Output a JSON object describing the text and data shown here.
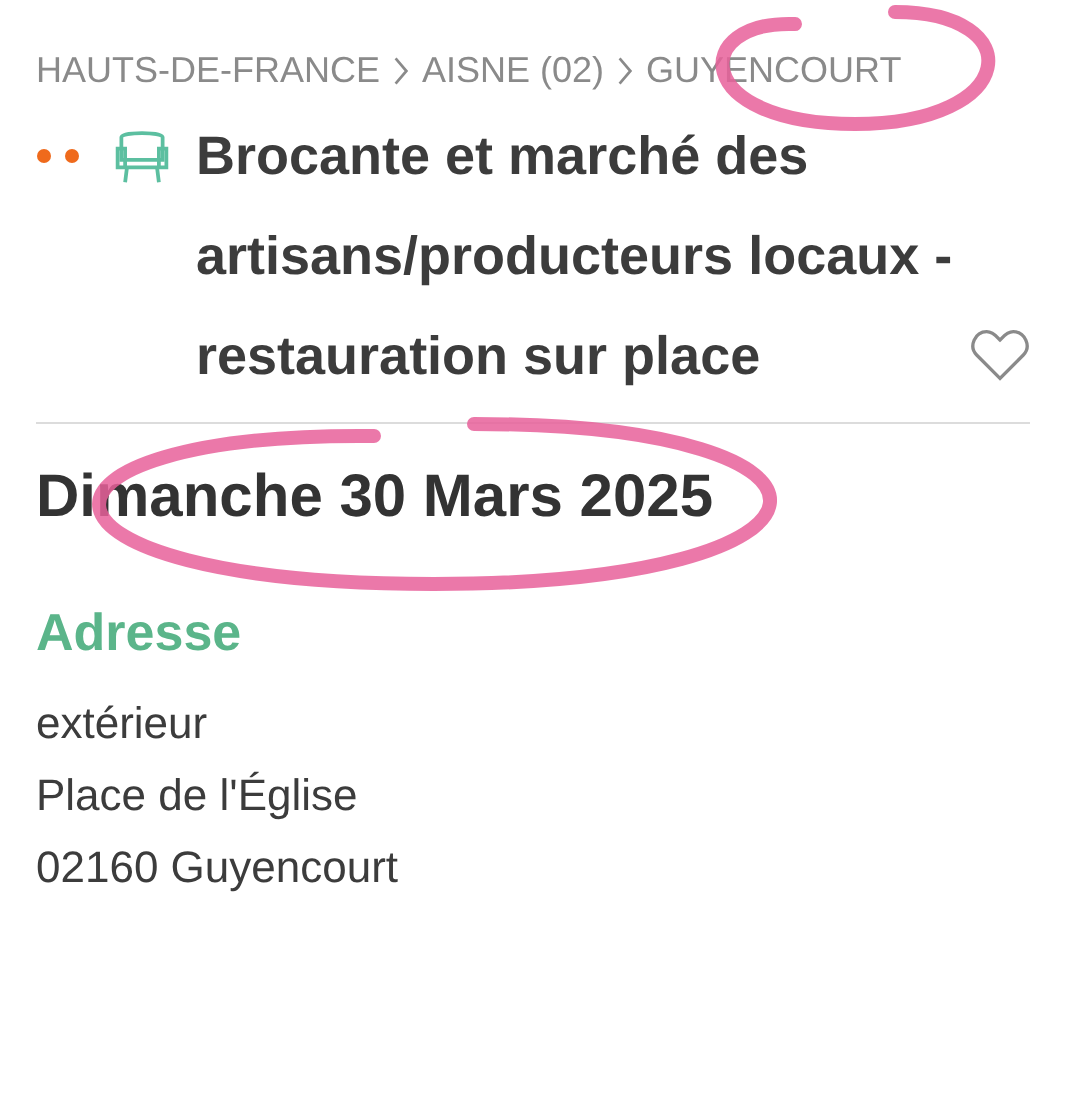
{
  "breadcrumb": [
    {
      "label": "HAUTS-DE-FRANCE"
    },
    {
      "label": "AISNE (02)"
    },
    {
      "label": "GUYENCOURT"
    }
  ],
  "event": {
    "title": "Brocante et marché des artisans/producteurs locaux - restauration sur place",
    "favorite": false,
    "date": "Dimanche 30 Mars 2025"
  },
  "address": {
    "heading": "Adresse",
    "lines": [
      "extérieur",
      "Place de l'Église",
      "02160 Guyencourt"
    ]
  },
  "pen_marks": [
    {
      "kind": "ellipse"
    },
    {
      "kind": "ellipse"
    }
  ]
}
